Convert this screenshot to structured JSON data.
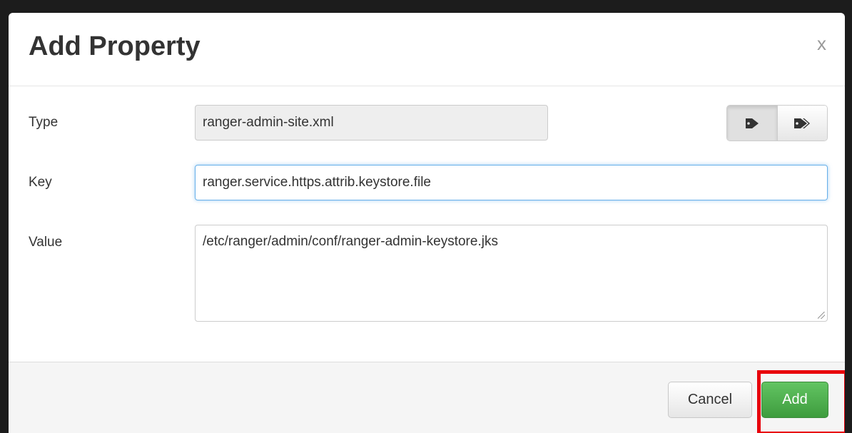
{
  "dialog": {
    "title": "Add Property",
    "close_label": "x"
  },
  "form": {
    "type_label": "Type",
    "type_value": "ranger-admin-site.xml",
    "key_label": "Key",
    "key_value": "ranger.service.https.attrib.keystore.file",
    "value_label": "Value",
    "value_value": "/etc/ranger/admin/conf/ranger-admin-keystore.jks"
  },
  "toggle": {
    "single_icon": "tag-icon",
    "multi_icon": "tags-icon",
    "active": "single"
  },
  "footer": {
    "cancel_label": "Cancel",
    "add_label": "Add"
  },
  "colors": {
    "add_button": "#4cae4c",
    "highlight": "#e8000b",
    "focus_border": "#66afe9"
  }
}
